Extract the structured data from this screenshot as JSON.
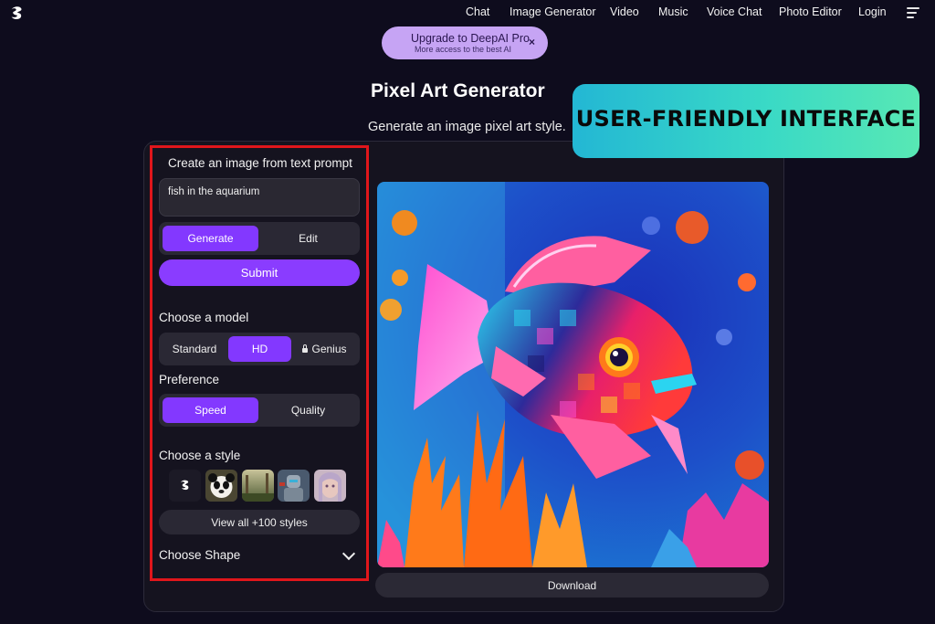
{
  "nav": {
    "items": [
      "Chat",
      "Image Generator",
      "Video",
      "Music",
      "Voice Chat",
      "Photo Editor",
      "Login"
    ]
  },
  "upgrade": {
    "title": "Upgrade to DeepAI Pro",
    "subtitle": "More access to the best AI",
    "close": "×"
  },
  "page": {
    "title": "Pixel Art Generator",
    "subtitle": "Generate an image pixel art style."
  },
  "banner": {
    "text": "USER-FRIENDLY INTERFACE"
  },
  "panel": {
    "heading": "Create an image from text prompt",
    "prompt_value": "fish in the aquarium",
    "mode_tabs": [
      "Generate",
      "Edit"
    ],
    "submit_label": "Submit",
    "model_label": "Choose a model",
    "models": [
      "Standard",
      "HD",
      "Genius"
    ],
    "preference_label": "Preference",
    "preferences": [
      "Speed",
      "Quality"
    ],
    "style_label": "Choose a style",
    "view_all_label": "View all +100 styles",
    "shape_label": "Choose Shape"
  },
  "result": {
    "download_label": "Download"
  },
  "colors": {
    "background": "#0e0c1d",
    "accent": "#8338ff",
    "highlight_border": "#e0161b",
    "banner_gradient": [
      "#23b7d4",
      "#58e8b4"
    ]
  }
}
